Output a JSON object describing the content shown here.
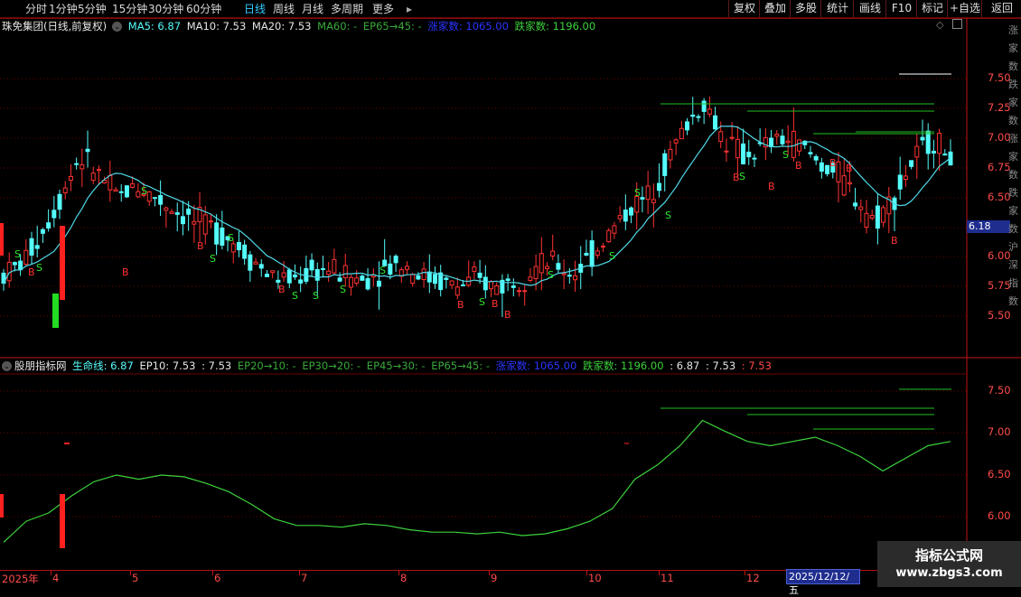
{
  "toolbar": {
    "timeframes": [
      "分时",
      "1分钟",
      "5分钟",
      "15分钟",
      "30分钟",
      "60分钟",
      "日线",
      "周线",
      "月线",
      "多周期",
      "更多"
    ],
    "active_timeframe": "日线",
    "more_arrow": "▸",
    "right_buttons": [
      "复权",
      "叠加",
      "多股",
      "统计",
      "画线",
      "F10",
      "标记",
      "+自选",
      "返回"
    ]
  },
  "main_legend": {
    "stock": "珠免集团(日线,前复权)",
    "ma5": "MA5: 6.87",
    "ma10": "MA10: 7.53",
    "ma20": "MA20: 7.53",
    "ma60": "MA60: -",
    "ep65": "EP65→45: -",
    "up_count": "涨家数: 1065.00",
    "down_count": "跌家数: 1196.00"
  },
  "sub_legend": {
    "name": "股朋指标网",
    "life_line": "生命线: 6.87",
    "ep10": "EP10: 7.53",
    "v1": ": 7.53",
    "ep20": "EP20→10: -",
    "ep30": "EP30→20: -",
    "ep45": "EP45→30: -",
    "ep65": "EP65→45: -",
    "up_count": "涨家数: 1065.00",
    "down_count": "跌家数: 1196.00",
    "v2": ": 6.87",
    "v3": ": 7.53",
    "v4": ": 7.53"
  },
  "main_axis": [
    "7.50",
    "7.25",
    "7.00",
    "6.75",
    "6.50",
    "6.25",
    "6.00",
    "5.75",
    "5.50"
  ],
  "current_price_tag": "6.18",
  "sub_axis": [
    "7.50",
    "7.00",
    "6.50",
    "6.00"
  ],
  "date_axis": [
    "2025年",
    "4",
    "5",
    "6",
    "7",
    "8",
    "9",
    "10",
    "11",
    "12"
  ],
  "cursor_date": "2025/12/12/五",
  "edge_text": "涨家数跌家数涨家数跌家数沪深指数",
  "colors": {
    "up": "#ff3232",
    "down": "#54fcfc",
    "ma": "#4fd9e8",
    "life": "#3cd23c",
    "grid": "#6b0000",
    "axis": "#c81414",
    "signal_b": "#ff3232",
    "signal_s": "#2ee82e"
  },
  "watermark": {
    "line1": "指标公式网",
    "line2": "www.zbgs3.com"
  },
  "chart_data": {
    "type": "candlestick",
    "price_range": [
      5.3,
      7.9
    ],
    "closes_approx": [
      5.85,
      5.95,
      6.2,
      6.5,
      6.85,
      6.7,
      6.5,
      6.6,
      6.5,
      6.4,
      6.3,
      6.25,
      6.15,
      6.0,
      5.85,
      5.8,
      5.85,
      5.9,
      5.85,
      5.8,
      5.9,
      5.95,
      5.85,
      5.8,
      5.75,
      5.8,
      5.75,
      5.8,
      5.9,
      5.95,
      5.85,
      6.0,
      6.2,
      6.4,
      6.5,
      6.8,
      7.1,
      7.3,
      7.0,
      6.85,
      6.9,
      7.0,
      6.95,
      6.8,
      6.7,
      6.5,
      6.3,
      6.5,
      6.8,
      7.0,
      6.85
    ],
    "signals": [
      {
        "t": "B"
      },
      {
        "t": "S"
      }
    ],
    "life_line_range": [
      5.7,
      7.15
    ]
  }
}
